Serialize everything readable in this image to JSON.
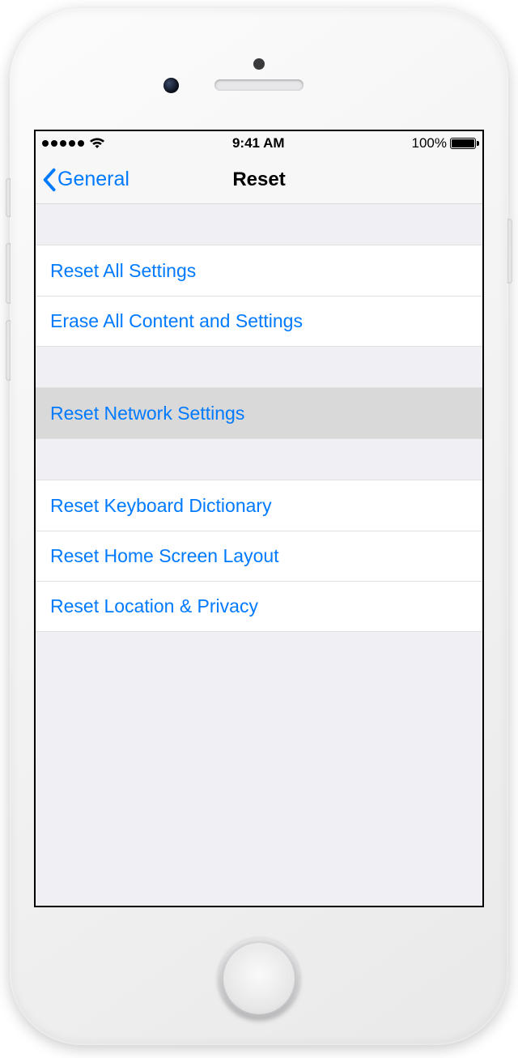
{
  "status": {
    "time": "9:41 AM",
    "battery": "100%"
  },
  "nav": {
    "back": "General",
    "title": "Reset"
  },
  "groups": [
    {
      "items": [
        {
          "label": "Reset All Settings",
          "selected": false
        },
        {
          "label": "Erase All Content and Settings",
          "selected": false
        }
      ]
    },
    {
      "items": [
        {
          "label": "Reset Network Settings",
          "selected": true
        }
      ]
    },
    {
      "items": [
        {
          "label": "Reset Keyboard Dictionary",
          "selected": false
        },
        {
          "label": "Reset Home Screen Layout",
          "selected": false
        },
        {
          "label": "Reset Location & Privacy",
          "selected": false
        }
      ]
    }
  ]
}
